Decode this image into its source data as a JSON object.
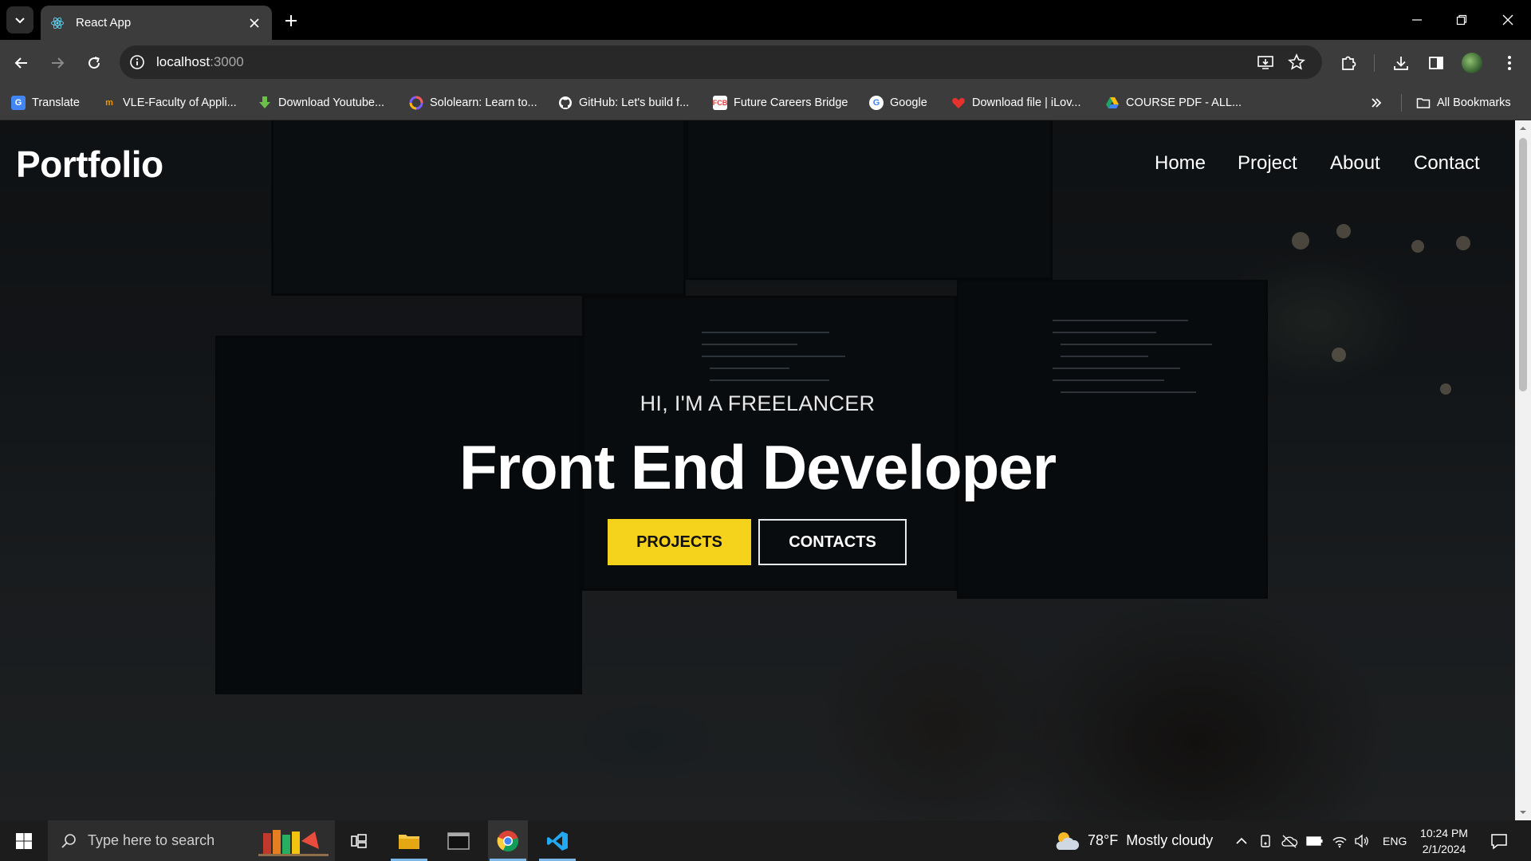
{
  "browser": {
    "tab_title": "React App",
    "url_host": "localhost",
    "url_port": ":3000",
    "bookmarks": [
      {
        "label": "Translate",
        "icon": "translate-icon",
        "color": "#4285f4"
      },
      {
        "label": "VLE-Faculty of Appli...",
        "icon": "vle-icon",
        "color": "#f29100"
      },
      {
        "label": "Download Youtube...",
        "icon": "download-arrow-icon",
        "color": "#6cc04a"
      },
      {
        "label": "Sololearn: Learn to...",
        "icon": "sololearn-icon",
        "color": "#7b5cff"
      },
      {
        "label": "GitHub: Let's build f...",
        "icon": "github-icon",
        "color": "#ffffff"
      },
      {
        "label": "Future Careers Bridge",
        "icon": "fcb-icon",
        "color": "#d84040"
      },
      {
        "label": "Google",
        "icon": "google-icon",
        "color": "#ffffff"
      },
      {
        "label": "Download file | iLov...",
        "icon": "heart-icon",
        "color": "#e5322d"
      },
      {
        "label": "COURSE PDF - ALL...",
        "icon": "drive-icon",
        "color": "#1fa463"
      }
    ],
    "all_bookmarks_label": "All Bookmarks"
  },
  "site": {
    "brand": "Portfolio",
    "nav": [
      "Home",
      "Project",
      "About",
      "Contact"
    ],
    "hero_subtitle": "HI, I'M A FREELANCER",
    "hero_title": "Front End Developer",
    "primary_button": "PROJECTS",
    "secondary_button": "CONTACTS",
    "accent_color": "#f5d21b"
  },
  "taskbar": {
    "search_placeholder": "Type here to search",
    "weather_temp": "78°F",
    "weather_desc": "Mostly cloudy",
    "language": "ENG",
    "time": "10:24 PM",
    "date": "2/1/2024"
  }
}
